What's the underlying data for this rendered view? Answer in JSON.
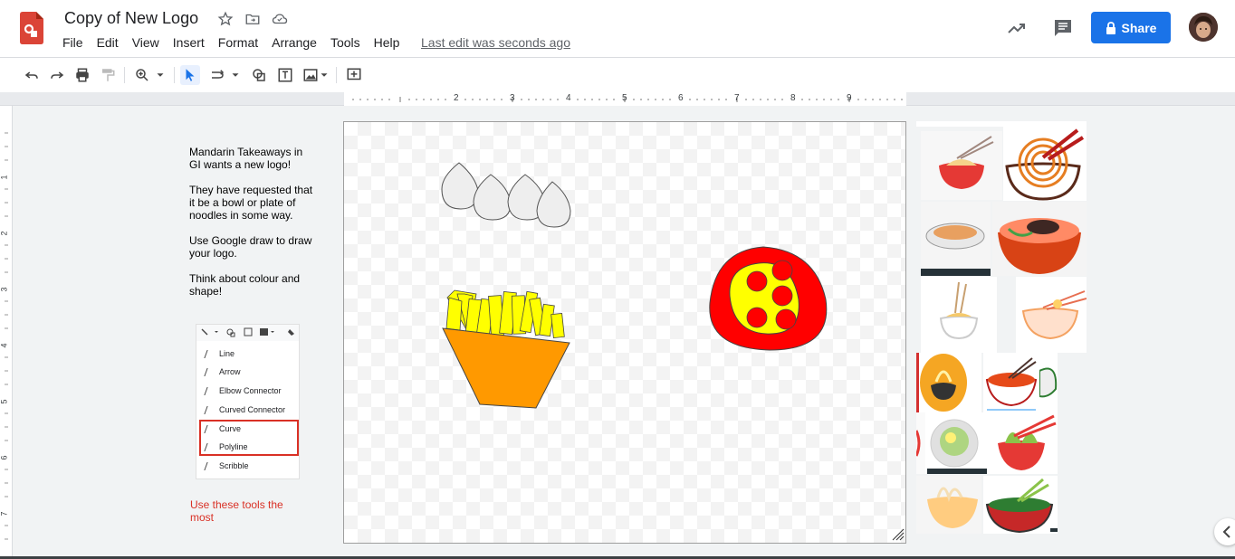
{
  "app": {
    "title": "Copy of New Logo",
    "last_edit": "Last edit was seconds ago",
    "share_label": "Share",
    "accent_color": "#1a73e8"
  },
  "menu": [
    "File",
    "Edit",
    "View",
    "Insert",
    "Format",
    "Arrange",
    "Tools",
    "Help"
  ],
  "toolbar": {
    "icons": [
      "undo-icon",
      "redo-icon",
      "print-icon",
      "paint-format-icon",
      "zoom-icon",
      "select-icon",
      "line-icon",
      "shape-icon",
      "textbox-icon",
      "image-icon",
      "new-comment-icon"
    ]
  },
  "ruler": {
    "top_numbers": [
      "2",
      "3",
      "4",
      "5",
      "6",
      "7",
      "8",
      "9"
    ],
    "left_numbers": [
      "1",
      "2",
      "3",
      "4",
      "5",
      "6",
      "7"
    ]
  },
  "instructions": {
    "p1": "Mandarin Takeaways in GI wants a new logo!",
    "p2": "They have requested that it be a bowl or plate of noodles in some way.",
    "p3": "Use Google draw to draw your logo.",
    "p4": "Think about colour and shape!",
    "note": "Use these tools the most"
  },
  "line_menu": {
    "items": [
      "Line",
      "Arrow",
      "Elbow Connector",
      "Curved Connector",
      "Curve",
      "Polyline",
      "Scribble"
    ]
  },
  "colors": {
    "highlight": "#d93025",
    "fries": "#ffff00",
    "fries_box": "#ff9900",
    "pizza_crust": "#ff0000",
    "pizza_cheese": "#ffff00"
  }
}
